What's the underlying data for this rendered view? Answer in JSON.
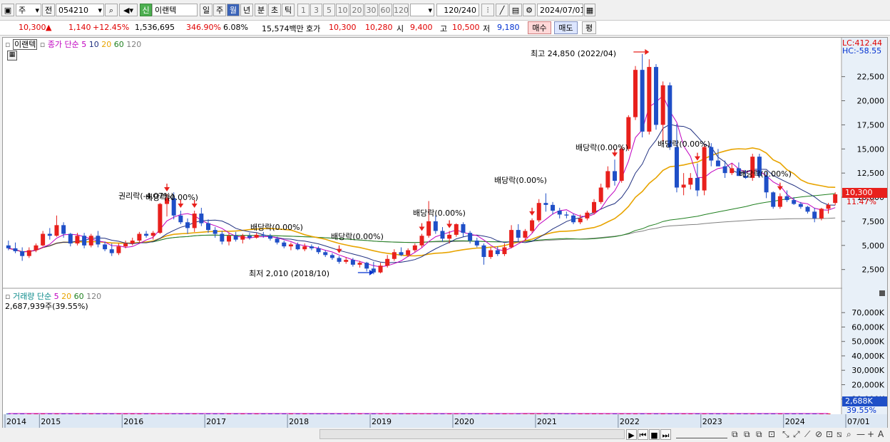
{
  "toolbar": {
    "period_type": "주",
    "prev_label": "전",
    "stock_code": "054210",
    "credit_badge": "신",
    "stock_name": "이랜텍",
    "tabs": [
      "일",
      "주",
      "월",
      "년",
      "분",
      "초",
      "틱"
    ],
    "selected_tab": "월",
    "intervals": [
      "1",
      "3",
      "5",
      "10",
      "20",
      "30",
      "60",
      "120"
    ],
    "count_value": "120",
    "count_total": "/240",
    "date": "2024/07/01"
  },
  "quote": {
    "price": "10,300",
    "arrow": "▲",
    "change": "1,140",
    "change_pct": "+12.45%",
    "volume": "1,536,695",
    "volume_ratio": "346.90%",
    "turnover": "6.08%",
    "amount": "15,574백만",
    "ask_label": "호가",
    "ask": "10,300",
    "bid": "10,280",
    "open_label": "시",
    "open": "9,400",
    "high_label": "고",
    "high": "10,500",
    "low_label": "저",
    "low": "9,180",
    "buy_label": "매수",
    "sell_label": "매도",
    "eval_label": "평"
  },
  "legend_price": {
    "name": "이랜텍",
    "label": "종가 단순",
    "periods": [
      "5",
      "10",
      "20",
      "60",
      "120"
    ]
  },
  "legend_volume": {
    "label": "거래량 단순",
    "periods": [
      "5",
      "20",
      "60",
      "120"
    ],
    "value": "2,687,939주(39.55%)"
  },
  "indicators": {
    "lc": "LC:412.44",
    "hc": "HC:-58.55",
    "current_price": "10,300",
    "current_pct": "11.47%",
    "current_volume": "2,688K",
    "current_volume_pct": "39.55%"
  },
  "annotations": {
    "max": "최고 24,850 (2022/04)",
    "min": "최저 2,010 (2018/10)",
    "rights": "권리락(-4.07%)",
    "dividend_labels": [
      "배당락(0.00%)",
      "배당락(0.00%)",
      "배당락(0.00%)",
      "배당락(0.00%)",
      "배당락(0.00%)",
      "배당락(0.00%)",
      "배당락(0.00%)",
      "배당락(0.00%)"
    ]
  },
  "chart_data": {
    "type": "candlestick",
    "period": "monthly",
    "y_axis_price": {
      "ticks": [
        "22,500",
        "20,000",
        "17,500",
        "15,000",
        "12,500",
        "10,000",
        "7,500",
        "5,000",
        "2,500"
      ],
      "range": [
        1000,
        25500
      ]
    },
    "y_axis_volume": {
      "ticks": [
        "70,000K",
        "60,000K",
        "50,000K",
        "40,000K",
        "30,000K",
        "20,000K",
        "10,000K"
      ],
      "range": [
        0,
        78000
      ]
    },
    "x_axis_labels": [
      "2014",
      "2015",
      "2016",
      "2017",
      "2018",
      "2019",
      "2020",
      "2021",
      "2022",
      "2023",
      "2024",
      "07/01"
    ],
    "colors": {
      "up": "#e8201c",
      "down": "#1f4fc7",
      "ma5": "#c000c0",
      "ma10": "#203080",
      "ma20": "#e8a400",
      "ma60": "#208020",
      "ma120": "#808080"
    },
    "candles": [
      {
        "o": 5000,
        "h": 5500,
        "l": 4500,
        "c": 4700
      },
      {
        "o": 4700,
        "h": 5300,
        "l": 4200,
        "c": 4400
      },
      {
        "o": 4400,
        "h": 4800,
        "l": 3400,
        "c": 3900
      },
      {
        "o": 3900,
        "h": 4800,
        "l": 3700,
        "c": 4500
      },
      {
        "o": 4500,
        "h": 5200,
        "l": 4300,
        "c": 5000
      },
      {
        "o": 5000,
        "h": 6500,
        "l": 4900,
        "c": 6200
      },
      {
        "o": 6200,
        "h": 6800,
        "l": 5600,
        "c": 6000
      },
      {
        "o": 6000,
        "h": 8100,
        "l": 5900,
        "c": 7100
      },
      {
        "o": 7100,
        "h": 7400,
        "l": 5800,
        "c": 6200
      },
      {
        "o": 6200,
        "h": 6300,
        "l": 4900,
        "c": 5200
      },
      {
        "o": 5200,
        "h": 6300,
        "l": 5000,
        "c": 6000
      },
      {
        "o": 6000,
        "h": 6300,
        "l": 4700,
        "c": 5000
      },
      {
        "o": 5000,
        "h": 6200,
        "l": 4800,
        "c": 6000
      },
      {
        "o": 6000,
        "h": 6500,
        "l": 4800,
        "c": 5100
      },
      {
        "o": 5100,
        "h": 5400,
        "l": 4400,
        "c": 4600
      },
      {
        "o": 4600,
        "h": 5200,
        "l": 3900,
        "c": 4200
      },
      {
        "o": 4200,
        "h": 5200,
        "l": 4000,
        "c": 4900
      },
      {
        "o": 4900,
        "h": 5500,
        "l": 4700,
        "c": 5200
      },
      {
        "o": 5200,
        "h": 5800,
        "l": 5000,
        "c": 5500
      },
      {
        "o": 5500,
        "h": 6400,
        "l": 5300,
        "c": 6200
      },
      {
        "o": 6200,
        "h": 6500,
        "l": 5800,
        "c": 6000
      },
      {
        "o": 6000,
        "h": 6500,
        "l": 5600,
        "c": 6300
      },
      {
        "o": 6300,
        "h": 9400,
        "l": 6200,
        "c": 9300
      },
      {
        "o": 9300,
        "h": 10300,
        "l": 8000,
        "c": 9900
      },
      {
        "o": 9900,
        "h": 10500,
        "l": 7700,
        "c": 8100
      },
      {
        "o": 8100,
        "h": 8600,
        "l": 7200,
        "c": 7400
      },
      {
        "o": 7400,
        "h": 7800,
        "l": 6200,
        "c": 6800
      },
      {
        "o": 6800,
        "h": 8600,
        "l": 6400,
        "c": 8300
      },
      {
        "o": 8300,
        "h": 8900,
        "l": 7000,
        "c": 7300
      },
      {
        "o": 7300,
        "h": 7700,
        "l": 6300,
        "c": 6600
      },
      {
        "o": 6600,
        "h": 6900,
        "l": 5800,
        "c": 6200
      },
      {
        "o": 6200,
        "h": 6500,
        "l": 5100,
        "c": 5400
      },
      {
        "o": 5400,
        "h": 6300,
        "l": 5000,
        "c": 6000
      },
      {
        "o": 6000,
        "h": 6400,
        "l": 5400,
        "c": 5600
      },
      {
        "o": 5600,
        "h": 6200,
        "l": 5200,
        "c": 6000
      },
      {
        "o": 6000,
        "h": 6300,
        "l": 5600,
        "c": 5800
      },
      {
        "o": 5800,
        "h": 6300,
        "l": 5700,
        "c": 6100
      },
      {
        "o": 6100,
        "h": 6400,
        "l": 5800,
        "c": 6000
      },
      {
        "o": 6000,
        "h": 6200,
        "l": 5500,
        "c": 5700
      },
      {
        "o": 5700,
        "h": 5900,
        "l": 5100,
        "c": 5300
      },
      {
        "o": 5300,
        "h": 5500,
        "l": 4700,
        "c": 4900
      },
      {
        "o": 4900,
        "h": 5300,
        "l": 4500,
        "c": 5100
      },
      {
        "o": 5100,
        "h": 5300,
        "l": 4500,
        "c": 4600
      },
      {
        "o": 4600,
        "h": 5200,
        "l": 4400,
        "c": 4900
      },
      {
        "o": 4900,
        "h": 5100,
        "l": 4500,
        "c": 4700
      },
      {
        "o": 4700,
        "h": 4900,
        "l": 4100,
        "c": 4300
      },
      {
        "o": 4300,
        "h": 4500,
        "l": 3800,
        "c": 4000
      },
      {
        "o": 4000,
        "h": 4200,
        "l": 3500,
        "c": 3700
      },
      {
        "o": 3700,
        "h": 3900,
        "l": 3100,
        "c": 3300
      },
      {
        "o": 3300,
        "h": 3800,
        "l": 3100,
        "c": 3500
      },
      {
        "o": 3500,
        "h": 3700,
        "l": 2800,
        "c": 3000
      },
      {
        "o": 3000,
        "h": 3400,
        "l": 2700,
        "c": 3200
      },
      {
        "o": 3200,
        "h": 3300,
        "l": 2300,
        "c": 2600
      },
      {
        "o": 2600,
        "h": 3300,
        "l": 2010,
        "c": 2200
      },
      {
        "o": 2200,
        "h": 3200,
        "l": 2100,
        "c": 2900
      },
      {
        "o": 2900,
        "h": 4000,
        "l": 2700,
        "c": 3600
      },
      {
        "o": 3600,
        "h": 4600,
        "l": 3400,
        "c": 4300
      },
      {
        "o": 4300,
        "h": 4800,
        "l": 3900,
        "c": 4000
      },
      {
        "o": 4000,
        "h": 4700,
        "l": 3800,
        "c": 4500
      },
      {
        "o": 4500,
        "h": 5200,
        "l": 4300,
        "c": 5000
      },
      {
        "o": 5000,
        "h": 6200,
        "l": 4800,
        "c": 6000
      },
      {
        "o": 6000,
        "h": 9600,
        "l": 5800,
        "c": 7500
      },
      {
        "o": 7500,
        "h": 8100,
        "l": 6200,
        "c": 6500
      },
      {
        "o": 6500,
        "h": 6900,
        "l": 5400,
        "c": 5700
      },
      {
        "o": 5700,
        "h": 6500,
        "l": 5200,
        "c": 6100
      },
      {
        "o": 6100,
        "h": 7300,
        "l": 5900,
        "c": 7200
      },
      {
        "o": 7200,
        "h": 7400,
        "l": 5900,
        "c": 6300
      },
      {
        "o": 6300,
        "h": 6500,
        "l": 5200,
        "c": 5500
      },
      {
        "o": 5500,
        "h": 5800,
        "l": 4800,
        "c": 5000
      },
      {
        "o": 5000,
        "h": 5200,
        "l": 3000,
        "c": 3800
      },
      {
        "o": 3800,
        "h": 4800,
        "l": 3600,
        "c": 4500
      },
      {
        "o": 4500,
        "h": 4900,
        "l": 3900,
        "c": 4100
      },
      {
        "o": 4100,
        "h": 5200,
        "l": 3900,
        "c": 4800
      },
      {
        "o": 4800,
        "h": 7100,
        "l": 4700,
        "c": 6600
      },
      {
        "o": 6600,
        "h": 7200,
        "l": 5400,
        "c": 5800
      },
      {
        "o": 5800,
        "h": 6700,
        "l": 5500,
        "c": 6500
      },
      {
        "o": 6500,
        "h": 7800,
        "l": 6300,
        "c": 7600
      },
      {
        "o": 7600,
        "h": 9800,
        "l": 7400,
        "c": 9400
      },
      {
        "o": 9400,
        "h": 10400,
        "l": 8500,
        "c": 9200
      },
      {
        "o": 9200,
        "h": 9500,
        "l": 8200,
        "c": 8600
      },
      {
        "o": 8600,
        "h": 8900,
        "l": 7800,
        "c": 8200
      },
      {
        "o": 8200,
        "h": 8500,
        "l": 7800,
        "c": 8100
      },
      {
        "o": 8100,
        "h": 8300,
        "l": 7200,
        "c": 7400
      },
      {
        "o": 7400,
        "h": 8200,
        "l": 7200,
        "c": 7800
      },
      {
        "o": 7800,
        "h": 8600,
        "l": 7600,
        "c": 8400
      },
      {
        "o": 8400,
        "h": 9800,
        "l": 8200,
        "c": 9500
      },
      {
        "o": 9500,
        "h": 11400,
        "l": 9300,
        "c": 11000
      },
      {
        "o": 11000,
        "h": 13200,
        "l": 10800,
        "c": 12700
      },
      {
        "o": 12700,
        "h": 13900,
        "l": 11200,
        "c": 11700
      },
      {
        "o": 11700,
        "h": 15300,
        "l": 11500,
        "c": 15000
      },
      {
        "o": 15000,
        "h": 18500,
        "l": 14800,
        "c": 18300
      },
      {
        "o": 18300,
        "h": 23600,
        "l": 18000,
        "c": 23200
      },
      {
        "o": 23200,
        "h": 24850,
        "l": 16200,
        "c": 16800
      },
      {
        "o": 16800,
        "h": 24300,
        "l": 16500,
        "c": 23500
      },
      {
        "o": 23500,
        "h": 23800,
        "l": 17000,
        "c": 17500
      },
      {
        "o": 17500,
        "h": 22000,
        "l": 15800,
        "c": 21600
      },
      {
        "o": 21600,
        "h": 21900,
        "l": 14900,
        "c": 15200
      },
      {
        "o": 15200,
        "h": 17600,
        "l": 10500,
        "c": 11000
      },
      {
        "o": 11000,
        "h": 12500,
        "l": 10200,
        "c": 11300
      },
      {
        "o": 11300,
        "h": 12500,
        "l": 10800,
        "c": 12000
      },
      {
        "o": 12000,
        "h": 13500,
        "l": 10100,
        "c": 10700
      },
      {
        "o": 10700,
        "h": 15500,
        "l": 10200,
        "c": 15200
      },
      {
        "o": 15200,
        "h": 15600,
        "l": 13200,
        "c": 13800
      },
      {
        "o": 13800,
        "h": 15000,
        "l": 13400,
        "c": 13200
      },
      {
        "o": 13200,
        "h": 13800,
        "l": 12000,
        "c": 12500
      },
      {
        "o": 12500,
        "h": 13500,
        "l": 12300,
        "c": 13000
      },
      {
        "o": 13000,
        "h": 13600,
        "l": 12300,
        "c": 12200
      },
      {
        "o": 12200,
        "h": 12800,
        "l": 11900,
        "c": 12000
      },
      {
        "o": 12000,
        "h": 14500,
        "l": 11700,
        "c": 14200
      },
      {
        "o": 14200,
        "h": 14500,
        "l": 12000,
        "c": 12200
      },
      {
        "o": 12200,
        "h": 12600,
        "l": 9900,
        "c": 10500
      },
      {
        "o": 10500,
        "h": 10600,
        "l": 8800,
        "c": 9000
      },
      {
        "o": 9000,
        "h": 10400,
        "l": 8800,
        "c": 10100
      },
      {
        "o": 10100,
        "h": 10700,
        "l": 9500,
        "c": 9700
      },
      {
        "o": 9700,
        "h": 10000,
        "l": 9200,
        "c": 9300
      },
      {
        "o": 9300,
        "h": 9500,
        "l": 8800,
        "c": 9000
      },
      {
        "o": 9000,
        "h": 9100,
        "l": 8300,
        "c": 8500
      },
      {
        "o": 8500,
        "h": 8900,
        "l": 7400,
        "c": 7800
      },
      {
        "o": 7800,
        "h": 8900,
        "l": 7600,
        "c": 8800
      },
      {
        "o": 8800,
        "h": 9400,
        "l": 8300,
        "c": 9200
      },
      {
        "o": 9400,
        "h": 10500,
        "l": 9180,
        "c": 10300
      }
    ],
    "volumes": [
      5,
      3,
      4,
      12,
      5,
      6,
      17,
      4,
      6,
      4,
      3,
      2,
      4,
      3,
      2,
      3,
      5,
      5,
      4,
      2,
      4,
      5,
      54,
      33,
      18,
      9,
      8,
      5,
      28,
      9,
      5,
      3,
      3,
      3,
      4,
      3,
      3,
      3,
      3,
      2,
      2,
      3,
      2,
      2,
      3,
      2,
      2,
      2,
      2,
      14,
      2,
      3,
      2,
      2,
      32,
      37,
      10,
      9,
      6,
      9,
      37,
      20,
      13,
      17,
      11,
      18,
      6,
      6,
      6,
      8,
      4,
      4,
      5,
      75,
      27,
      45,
      37,
      28,
      26,
      17,
      21,
      9,
      18,
      11,
      9,
      10,
      19,
      30,
      18,
      15,
      11,
      16,
      14,
      12,
      14,
      8,
      11,
      14,
      12,
      13,
      7,
      16,
      12,
      6,
      8,
      9,
      7,
      5,
      5,
      7,
      4,
      4,
      3,
      2,
      2,
      2,
      2,
      3,
      6,
      2.7
    ]
  },
  "bottombar": {
    "dash": "—",
    "plus": "+",
    "a": "A"
  }
}
